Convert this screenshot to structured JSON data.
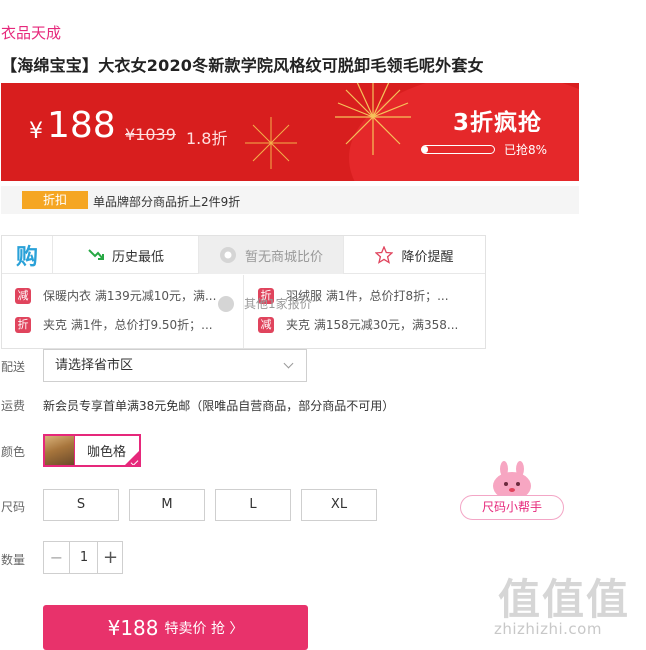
{
  "brand": "衣品天成",
  "title": "【海绵宝宝】大衣女2020冬新款学院风格纹可脱卸毛领毛呢外套女",
  "banner": {
    "currency": "¥",
    "price": "188",
    "original_price": "¥1039",
    "discount": "1.8折",
    "flash_title": "3折疯抢",
    "sold_text": "已抢8%",
    "sold_fraction": 0.08,
    "bg_color": "#d81e1e"
  },
  "promo": {
    "tag": "折扣",
    "text": "单品牌部分商品折上2件9折"
  },
  "tabs": {
    "gou_label": "购",
    "history": "历史最低",
    "compare": "暂无商城比价",
    "alert": "降价提醒"
  },
  "offers": [
    {
      "badge": "减",
      "text": "保暖内衣 满139元减10元，满..."
    },
    {
      "badge": "折",
      "text": "夹克 满1件，总价打9.50折；..."
    },
    {
      "badge": "折",
      "text": "羽绒服 满1件，总价打8折；..."
    },
    {
      "badge": "减",
      "text": "夹克 满158元减30元，满358..."
    }
  ],
  "overlay_tip": "其他1家报价",
  "shipping": {
    "label": "配送",
    "select_value": "请选择省市区"
  },
  "fee": {
    "label": "运费",
    "text": "新会员专享首单满38元免邮（限唯品自营商品，部分商品不可用）"
  },
  "color": {
    "label": "颜色",
    "selected": "咖色格"
  },
  "size": {
    "label": "尺码",
    "options": [
      "S",
      "M",
      "L",
      "XL"
    ]
  },
  "helper": {
    "label": "尺码小帮手"
  },
  "quantity": {
    "label": "数量",
    "value": "1",
    "minus": "−",
    "plus": "+"
  },
  "buy_button": {
    "price": "¥188",
    "label": "特卖价 抢 〉"
  },
  "watermark": {
    "logo": "值值值",
    "url": "zhizhizhi.com"
  },
  "colors": {
    "accent_pink": "#e6287b",
    "buy_button": "#e8326b",
    "badge_red": "#e0445d",
    "promo_orange": "#f5a623"
  }
}
